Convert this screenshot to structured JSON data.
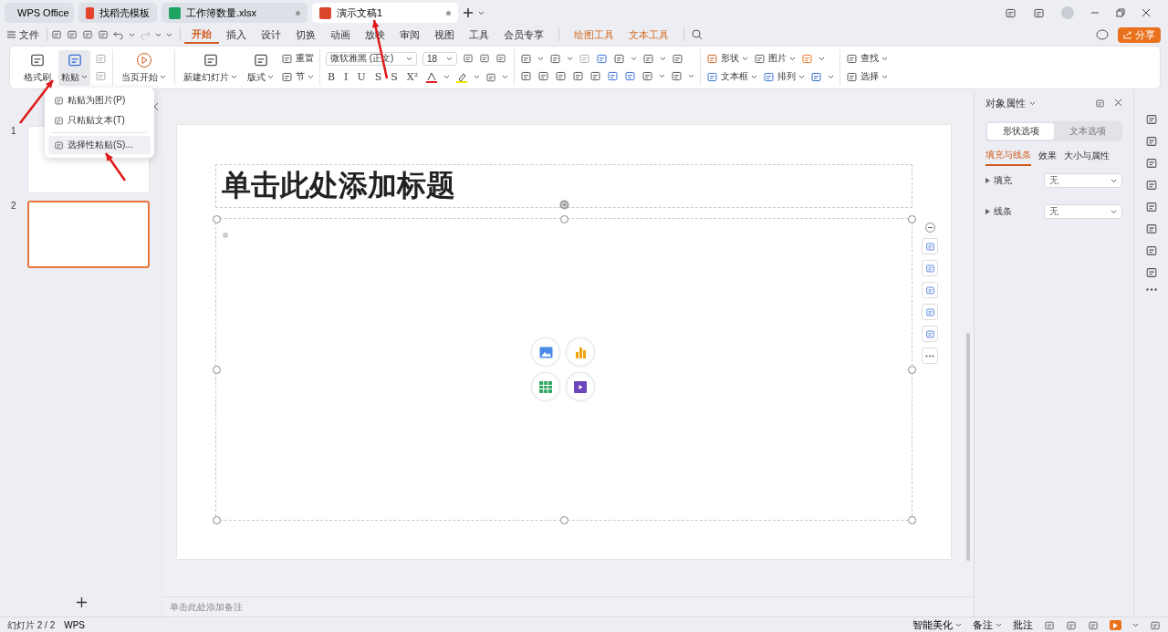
{
  "window_tabs": [
    {
      "label": "WPS Office",
      "kind": "home",
      "selected": false
    },
    {
      "label": "找稻壳模板",
      "kind": "template",
      "selected": false
    },
    {
      "label": "工作簿数量.xlsx",
      "kind": "sheet",
      "selected": false
    },
    {
      "label": "演示文稿1",
      "kind": "slides",
      "selected": true
    }
  ],
  "menu": {
    "file": "文件",
    "tabs": [
      {
        "label": "开始",
        "kind": "main",
        "selected": true
      },
      {
        "label": "插入",
        "kind": "main",
        "selected": false
      },
      {
        "label": "设计",
        "kind": "main",
        "selected": false
      },
      {
        "label": "切换",
        "kind": "main",
        "selected": false
      },
      {
        "label": "动画",
        "kind": "main",
        "selected": false
      },
      {
        "label": "放映",
        "kind": "main",
        "selected": false
      },
      {
        "label": "审阅",
        "kind": "main",
        "selected": false
      },
      {
        "label": "视图",
        "kind": "main",
        "selected": false
      },
      {
        "label": "工具",
        "kind": "main",
        "selected": false
      },
      {
        "label": "会员专享",
        "kind": "main",
        "selected": false
      },
      {
        "label": "绘图工具",
        "kind": "context",
        "selected": false
      },
      {
        "label": "文本工具",
        "kind": "context",
        "selected": false
      }
    ],
    "share": "分享"
  },
  "ribbon": {
    "format_painter": "格式刷",
    "paste": {
      "label": "粘贴",
      "selected": true
    },
    "start_show": "当页开始",
    "new_slide": "新建幻灯片",
    "layout": "版式",
    "reset": "重置",
    "section": "节",
    "font": {
      "value": "微软雅黑 (正文)"
    },
    "size": {
      "value": "18"
    },
    "format_buttons": [
      "B",
      "I",
      "U",
      "S",
      "S",
      "X²"
    ],
    "shape": "形状",
    "picture": "图片",
    "textbox": "文本框",
    "arrange": "排列",
    "find": "查找",
    "select": "选择"
  },
  "paste_menu": [
    {
      "label": "粘贴为图片(P)",
      "selected": false
    },
    {
      "label": "只粘贴文本(T)",
      "selected": false
    },
    {
      "label": "选择性粘贴(S)...",
      "selected": true
    }
  ],
  "slides": [
    {
      "number": "1",
      "selected": false
    },
    {
      "number": "2",
      "selected": true
    }
  ],
  "slide": {
    "title_placeholder": "单击此处添加标题"
  },
  "notes_placeholder": "单击此处添加备注",
  "panel": {
    "title": "对象属性",
    "tabs": [
      {
        "label": "形状选项",
        "selected": true
      },
      {
        "label": "文本选项",
        "selected": false
      }
    ],
    "subtabs": [
      {
        "label": "填充与线条",
        "selected": true
      },
      {
        "label": "效果",
        "selected": false
      },
      {
        "label": "大小与属性",
        "selected": false
      }
    ],
    "rows": [
      {
        "label": "填充",
        "value": "无"
      },
      {
        "label": "线条",
        "value": "无"
      }
    ]
  },
  "status_bar": {
    "slide_count": "幻灯片 2 / 2",
    "theme": "WPS",
    "beautify": "智能美化",
    "notes": "备注",
    "comments": "批注"
  }
}
